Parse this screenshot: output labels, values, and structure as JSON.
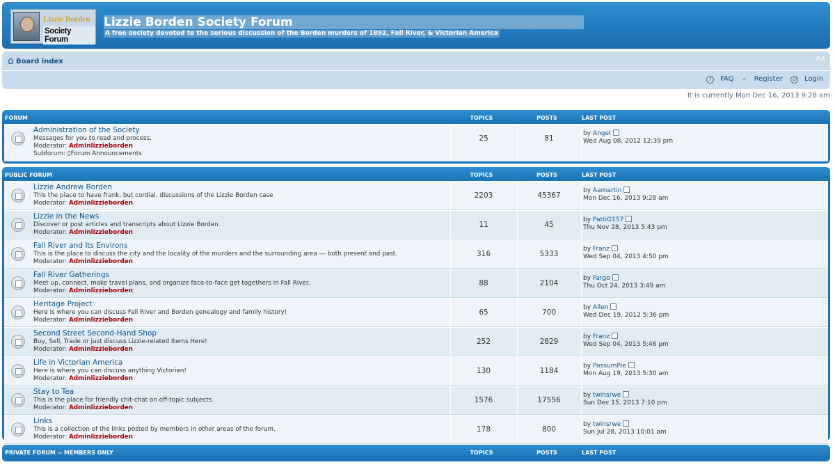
{
  "header": {
    "logo_line1": "Lizzie Borden",
    "logo_line2": "Society Forum",
    "site_title": "Lizzie Borden Society Forum",
    "site_desc": "A free society devoted to the serious discussion of the Borden murders of 1892, Fall River, & Victorian America"
  },
  "nav": {
    "board_index": "Board index",
    "resize": "A A",
    "faq": "FAQ",
    "register": "Register",
    "login": "Login",
    "current_time": "It is currently Mon Dec 16, 2013 9:28 am"
  },
  "blocks": [
    {
      "heading": "Forum",
      "col_topics": "Topics",
      "col_posts": "Posts",
      "col_lastpost": "Last post",
      "rows": [
        {
          "title": "Administration of the Society",
          "desc": "Messages for you to read and process.",
          "mod_label": "Moderator:",
          "mod_name": "Adminlizzieborden",
          "subforum_label": "Subforum:",
          "subforum_name": "Forum Announcements",
          "topics": "25",
          "posts": "81",
          "lp_by": "by",
          "lp_user": "Angel",
          "lp_date": "Wed Aug 08, 2012 12:39 pm"
        }
      ]
    },
    {
      "heading": "Public Forum",
      "col_topics": "Topics",
      "col_posts": "Posts",
      "col_lastpost": "Last post",
      "rows": [
        {
          "title": "Lizzie Andrew Borden",
          "desc": "This the place to have frank, but cordial, discussions of the Lizzie Borden case",
          "mod_label": "Moderator:",
          "mod_name": "Adminlizzieborden",
          "topics": "2203",
          "posts": "45367",
          "lp_by": "by",
          "lp_user": "Aamartin",
          "lp_date": "Mon Dec 16, 2013 9:28 am"
        },
        {
          "title": "Lizzie in the News",
          "desc": "Discover or post articles and transcripts about Lizzie Borden.",
          "mod_label": "Moderator:",
          "mod_name": "Adminlizzieborden",
          "topics": "11",
          "posts": "45",
          "lp_by": "by",
          "lp_user": "PattiG157",
          "lp_date": "Thu Nov 28, 2013 5:43 pm"
        },
        {
          "title": "Fall River and Its Environs",
          "desc": "This is the place to discuss the city and the locality of the murders and the surrounding area --- both present and past.",
          "mod_label": "Moderator:",
          "mod_name": "Adminlizzieborden",
          "topics": "316",
          "posts": "5333",
          "lp_by": "by",
          "lp_user": "Franz",
          "lp_date": "Wed Sep 04, 2013 4:50 pm"
        },
        {
          "title": "Fall River Gatherings",
          "desc": "Meet up, connect, make travel plans, and organize face-to-face get togethers in Fall River.",
          "mod_label": "Moderator:",
          "mod_name": "Adminlizzieborden",
          "topics": "88",
          "posts": "2104",
          "lp_by": "by",
          "lp_user": "Fargo",
          "lp_date": "Thu Oct 24, 2013 3:49 am"
        },
        {
          "title": "Heritage Project",
          "desc": "Here is where you can discuss Fall River and Borden genealogy and family history!",
          "mod_label": "Moderator:",
          "mod_name": "Adminlizzieborden",
          "topics": "65",
          "posts": "700",
          "lp_by": "by",
          "lp_user": "Allen",
          "lp_date": "Wed Dec 19, 2012 5:36 pm"
        },
        {
          "title": "Second Street Second-Hand Shop",
          "desc": "Buy, Sell, Trade or just discuss Lizzie-related Items Here!",
          "mod_label": "Moderator:",
          "mod_name": "Adminlizzieborden",
          "topics": "252",
          "posts": "2829",
          "lp_by": "by",
          "lp_user": "Franz",
          "lp_date": "Wed Sep 04, 2013 5:46 pm"
        },
        {
          "title": "Life in Victorian America",
          "desc": "Here is where you can discuss anything Victorian!",
          "mod_label": "Moderator:",
          "mod_name": "Adminlizzieborden",
          "topics": "130",
          "posts": "1184",
          "lp_by": "by",
          "lp_user": "PossumPie",
          "lp_date": "Mon Aug 19, 2013 5:30 am"
        },
        {
          "title": "Stay to Tea",
          "desc": "This is the place for friendly chit-chat on off-topic subjects.",
          "mod_label": "Moderator:",
          "mod_name": "Adminlizzieborden",
          "topics": "1576",
          "posts": "17556",
          "lp_by": "by",
          "lp_user": "twinsrwe",
          "lp_date": "Sun Dec 15, 2013 7:10 pm"
        },
        {
          "title": "Links",
          "desc": "This is a collection of the links posted by members in other areas of the forum.",
          "mod_label": "Moderator:",
          "mod_name": "Adminlizzieborden",
          "topics": "178",
          "posts": "800",
          "lp_by": "by",
          "lp_user": "twinsrwe",
          "lp_date": "Sun Jul 28, 2013 10:01 am"
        }
      ]
    },
    {
      "heading": "Private Forum -- Members Only",
      "col_topics": "Topics",
      "col_posts": "Posts",
      "col_lastpost": "Last post",
      "rows": []
    }
  ],
  "colors": {
    "header_blue": "#1b6db1",
    "link_blue": "#105289",
    "moderator_red": "#aa0000",
    "row_light": "#eef4f9",
    "row_alt": "#e1ebf4"
  }
}
